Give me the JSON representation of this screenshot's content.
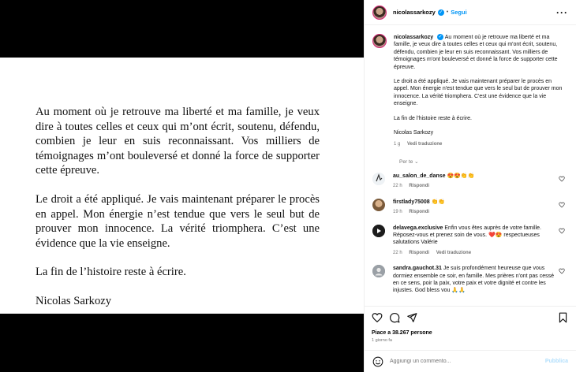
{
  "post": {
    "letter_paragraphs": [
      "Au moment où je retrouve ma liberté et ma famille, je veux dire à toutes celles et ceux qui m’ont écrit, soutenu, défendu, combien je leur en suis reconnaissant. Vos milliers de témoignages m’ont bouleversé et donné la force de supporter cette épreuve.",
      "Le droit a été appliqué. Je vais maintenant préparer le procès en appel. Mon énergie n’est tendue que vers le seul but de prouver mon innocence. La vérité triomphera. C’est une évidence que la vie enseigne.",
      "La fin de l’histoire reste à écrire.",
      "Nicolas Sarkozy"
    ]
  },
  "header": {
    "username": "nicolassarkozy",
    "separator": "•",
    "follow_label": "Segui",
    "more_label": "···"
  },
  "caption": {
    "username": "nicolassarkozy",
    "p1": "Au moment où je retrouve ma liberté et ma famille, je veux dire à toutes celles et ceux qui m'ont écrit, soutenu, défendu, combien je leur en suis reconnaissant. Vos milliers de témoignages m'ont bouleversé et donné la force de supporter cette épreuve.",
    "p2": "Le droit a été appliqué. Je vais maintenant préparer le procès en appel. Mon énergie n'est tendue que vers le seul but de prouver mon innocence. La vérité triomphera. C'est une évidence que la vie enseigne.",
    "p3": "La fin de l'histoire reste à écrire.",
    "p4": "Nicolas Sarkozy",
    "time": "1 g",
    "translate": "Vedi traduzione"
  },
  "sort_label": "Per te ⌄",
  "comments": [
    {
      "username": "au_salon_de_danse",
      "text": "😍😍👏👏",
      "time": "22 h",
      "reply": "Rispondi",
      "translate": ""
    },
    {
      "username": "firstlady75008",
      "text": "👏👏",
      "time": "19 h",
      "reply": "Rispondi",
      "translate": ""
    },
    {
      "username": "delavega.exclusive",
      "text": "Enfin vous êtes auprès de votre famille. Réposez-vous et prenez soin de vous. ❤️😍 respectueuses salutations Valérie",
      "time": "22 h",
      "reply": "Rispondi",
      "translate": "Vedi traduzione"
    },
    {
      "username": "sandra.gauchot.31",
      "text": "Je suis profondément heureuse que vous dormiez ensemble ce soir, en famille. Mes prières n'ont pas cessé en ce sens, poir la paix, votre paix et votre dignité et contre les injustes. God bless vou 🙏🙏",
      "time": "",
      "reply": "",
      "translate": ""
    }
  ],
  "actions": {
    "likes": "Piace a 38.267 persone",
    "date": "1 giorno fa"
  },
  "add_comment": {
    "placeholder": "Aggiungi un commento...",
    "publish": "Pubblica"
  },
  "colors": {
    "accent": "#0095f6",
    "muted": "#737373"
  }
}
